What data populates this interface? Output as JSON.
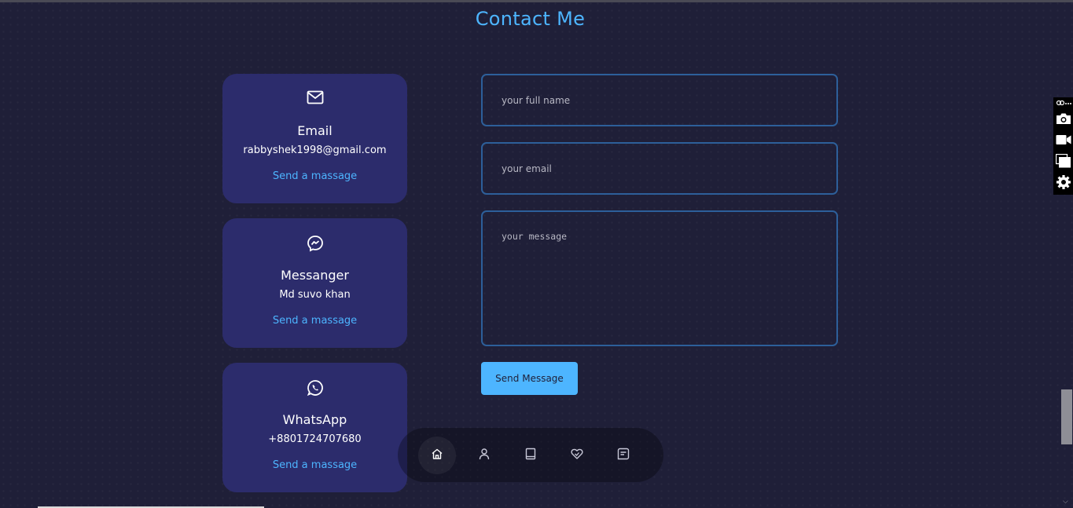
{
  "page": {
    "title": "Contact Me"
  },
  "cards": [
    {
      "title": "Email",
      "value": "rabbyshek1998@gmail.com",
      "link": "Send a massage",
      "icon": "mail-icon"
    },
    {
      "title": "Messanger",
      "value": "Md suvo khan",
      "link": "Send a massage",
      "icon": "messenger-icon"
    },
    {
      "title": "WhatsApp",
      "value": "+8801724707680",
      "link": "Send a massage",
      "icon": "whatsapp-icon"
    }
  ],
  "form": {
    "name_placeholder": "your full name",
    "email_placeholder": "your email",
    "message_placeholder": "your message",
    "name_value": "",
    "email_value": "",
    "message_value": "",
    "submit_label": "Send Message"
  },
  "nav": {
    "items": [
      {
        "icon": "home-icon",
        "active": true
      },
      {
        "icon": "user-icon",
        "active": false
      },
      {
        "icon": "book-icon",
        "active": false
      },
      {
        "icon": "services-icon",
        "active": false
      },
      {
        "icon": "message-icon",
        "active": false
      }
    ]
  },
  "toolbar": {
    "items": [
      "link-icon",
      "camera-icon",
      "video-icon",
      "copy-icon",
      "settings-icon"
    ]
  },
  "colors": {
    "background": "#1f1f38",
    "card": "#2c2c6c",
    "accent": "#4db5ff",
    "field_border": "#2d5f9a"
  }
}
